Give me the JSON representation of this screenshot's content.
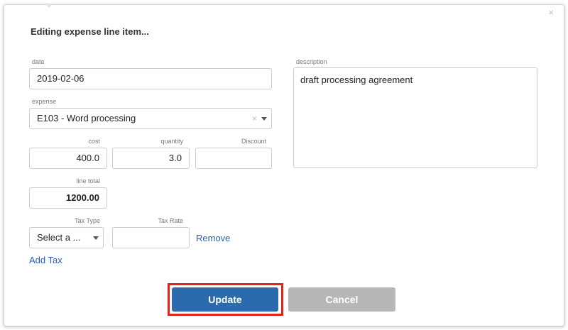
{
  "dialog": {
    "title": "Editing expense line item...",
    "close_glyph": "×"
  },
  "form": {
    "date_label": "date",
    "date_value": "2019-02-06",
    "expense_label": "expense",
    "expense_value": "E103 - Word processing",
    "clear_glyph": "×",
    "cost_label": "cost",
    "cost_value": "400.0",
    "quantity_label": "quantity",
    "quantity_value": "3.0",
    "discount_label": "Discount",
    "discount_value": "",
    "line_total_label": "line total",
    "line_total_value": "1200.00",
    "tax_type_label": "Tax Type",
    "tax_type_value": "Select a ...",
    "tax_rate_label": "Tax Rate",
    "tax_rate_value": "",
    "remove_link": "Remove",
    "add_tax_link": "Add Tax",
    "description_label": "description",
    "description_value": "draft processing agreement"
  },
  "actions": {
    "update_label": "Update",
    "cancel_label": "Cancel"
  },
  "colors": {
    "update": "#2a6aad",
    "cancel": "#b7b7b7",
    "highlight": "#e0251b",
    "link": "#2a5db0"
  }
}
